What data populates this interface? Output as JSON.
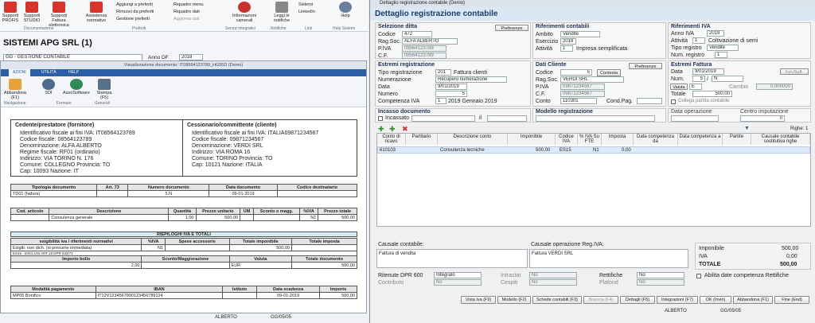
{
  "ribbon": {
    "buttons": [
      {
        "label": "Supporti PROFIS"
      },
      {
        "label": "Supporti STUDIO"
      },
      {
        "label": "Supporti Fattura elettronica"
      },
      {
        "label": "Assistenza normativo"
      }
    ],
    "prefs": [
      "Aggiungi a preferiti",
      "Rimuovi da preferiti",
      "Gestione preferiti"
    ],
    "riquadro": [
      "Riquadro menu",
      "Riquadro dati",
      "Aggiorna dati"
    ],
    "info": "Informazioni camerali",
    "notif": "Leggi le notifiche",
    "links": [
      "Sistemi",
      "LinkedIn"
    ],
    "help": "Help",
    "groups": [
      "Documentazione",
      "Preferiti",
      "Servizi integrativi",
      "Notifiche",
      "Link",
      "Help Sistemi"
    ]
  },
  "company": "SISTEMI APG SRL (1)",
  "gestione": "GG - GESTIONE CONTABILE",
  "anno_df_label": "Anno DF",
  "anno_df": "2018",
  "viewer": {
    "title": "Visualizzazione documento: IT08564123789_HG55D (Demo)",
    "tabs": [
      "AZIONI",
      "UTILITÀ",
      "HELP"
    ],
    "tools": [
      "Abbandona (F1)",
      "SDI",
      "AssoSoftware",
      "Stampa (F5)"
    ],
    "tool_groups": [
      "Navigazione",
      "Formato",
      "Generali"
    ]
  },
  "invoice": {
    "cedente_title": "Cedente/prestatore (fornitore)",
    "cedente": [
      "Identificativo fiscale ai fini IVA: IT08564123789",
      "Codice fiscale: 08564123789",
      "Denominazione: ALFA ALBERTO",
      "Regime fiscale: RF01 (ordinario)",
      "Indirizzo: VIA TORINO N. 176",
      "Comune: COLLEGNO Provincia: TO",
      "Cap: 10093 Nazione: IT"
    ],
    "cess_title": "Cessionario/committente (cliente)",
    "cess": [
      "Identificativo fiscale ai fini IVA: ITALIA09871234567",
      "Codice fiscale: 09871234567",
      "Denominazione: VERDI SRL",
      "Indirizzo: VIA ROMA 16",
      "Comune: TORINO Provincia: TO",
      "Cap: 10121 Nazione: ITALIA"
    ],
    "doc_headers": [
      "Tipologia documento",
      "Art. 73",
      "Numero documento",
      "Data documento",
      "Codice destinatario"
    ],
    "doc_row": [
      "TD01 (fattura)",
      "",
      "5.N",
      "09-01-2019",
      ""
    ],
    "line_headers": [
      "Cod. articolo",
      "Descrizione",
      "Quantità",
      "Prezzo unitario",
      "UM",
      "Sconto o magg.",
      "%IVA",
      "Prezzo totale"
    ],
    "line_row": [
      "",
      "Consulenza generale",
      "1,00",
      "500,00",
      "",
      "",
      "N1",
      "500,00"
    ],
    "riep_title": "RIEPILOGHI IVA E TOTALI",
    "riep_headers": [
      "esigibilità iva / riferimenti normativi",
      "%IVA",
      "Spese accessorie",
      "Totale imponibile",
      "Totale imposta"
    ],
    "riep_row": [
      "Esigib. non dich. (si presume immediata)",
      "N1",
      "",
      "500,00",
      ""
    ],
    "riep_note": "ES15 - ESCLUSI ART.15 DPR 633/72",
    "tot_headers": [
      "Importo bollo",
      "Sconto/Maggiorazione",
      "Valuta",
      "Totale documento"
    ],
    "tot_row": [
      "2,00",
      "",
      "EUR",
      "500,00"
    ],
    "pay_headers": [
      "Modalità pagamento",
      "IBAN",
      "Istituto",
      "Data scadenza",
      "Importo"
    ],
    "pay_row": [
      "MP05 Bonifico",
      "IT12V1234567890123456789124",
      "",
      "09-01-2019",
      "500,00"
    ]
  },
  "status_left": {
    "user": "ALBERTO",
    "code": "GG/05/05"
  },
  "dialog": {
    "wtitle": "Dettaglio registrazione contabile (Demo)",
    "header": "Dettaglio registrazione contabile",
    "sel_ditta": {
      "title": "Selezione ditta",
      "preferenze": "Preferenze",
      "codice_l": "Codice",
      "codice": "472",
      "ragsoc_l": "Rag.Soc.",
      "ragsoc": "ALFA ALBERTO",
      "piva_l": "P.IVA",
      "piva": "08564123789",
      "cf_l": "C.F.",
      "cf": "08564123789"
    },
    "rif_cont": {
      "title": "Riferimenti contabili",
      "ambito_l": "Ambito",
      "ambito": "Vendite",
      "esercizio_l": "Esercizio",
      "esercizio": "2019",
      "attivita_l": "Attività",
      "attivita": "1",
      "attivita_desc": "Impresa semplificata"
    },
    "rif_iva": {
      "title": "Riferimenti IVA",
      "anno_l": "Anno IVA",
      "anno": "2019",
      "attivita_l": "Attività",
      "attivita": "1",
      "attivita_desc": "Coltivazione di semi",
      "tipo_l": "Tipo registro",
      "tipo": "Vendite",
      "num_l": "Num. registro",
      "num": "1"
    },
    "estremi": {
      "title": "Estremi registrazione",
      "tipo_l": "Tipo registrazione",
      "tipo": "201",
      "tipo_desc": "Fattura clienti",
      "num_l": "Numerazione",
      "num": "Recupero numerazione",
      "data_l": "Data",
      "data": "9/01/2019",
      "numero_l": "Numero",
      "numero": "5",
      "comp_l": "Competenza IVA",
      "comp_m": "1",
      "comp": "2019 Gennaio 2019"
    },
    "cliente": {
      "title": "Dati Cliente",
      "preferenze": "Preferenze",
      "codice_l": "Codice",
      "codice": "5",
      "contesta": "Contesta",
      "ragsoc_l": "Rag.Soc.",
      "ragsoc": "VERDI SRL",
      "piva_l": "P.IVA",
      "piva": "09871234567",
      "cf_l": "C.F.",
      "cf": "09871234567",
      "conto_l": "Conto",
      "conto": "110301",
      "condpag_l": "Cond.Pag."
    },
    "fattura": {
      "title": "Estremi Fattura",
      "fel": "Fel./Suff.",
      "data_l": "Data",
      "data": "9/01/2019",
      "num_l": "Num.",
      "num": "5",
      "num_suf": "N",
      "valuta": "Valuta",
      "valuta_v": "E",
      "cambio_l": "Cambio",
      "cambio": "0,000000",
      "totale_l": "Totale",
      "totale": "500,00",
      "collega": "Collega partita contabile"
    },
    "incasso": {
      "title": "Incasso documento",
      "chk": "Incassato",
      "il": "il"
    },
    "modello": {
      "title": "Modello registrazione"
    },
    "dataop": {
      "title": "Data operazione"
    },
    "centro": {
      "title": "Centro imputazione",
      "v": "0"
    },
    "righe": "Righe: 1",
    "grid_headers": [
      "Conto di ricavo",
      "Partitario",
      "Descrizione conto",
      "Imponibile",
      "Codice IVA",
      "% IVA Su FTE",
      "Imposta",
      "Data competenza da",
      "Data competenza a",
      "Partite",
      "Causale contabile sostitutiva righe"
    ],
    "grid_row": {
      "conto": "610103",
      "desc": "Consulenza tecniche",
      "imp": "500,00",
      "cod": "ES15",
      "iva": "N1",
      "imposta": "0,00"
    },
    "causale_l": "Causale contabile:",
    "causale": "Fattura di vendita",
    "causale_iva_l": "Causale operazione Reg.IVA:",
    "causale_iva": "Fattura VERDI SRL",
    "totals": {
      "imp_l": "Imponibile",
      "imp": "500,00",
      "iva_l": "IVA",
      "iva": "0,00",
      "tot_l": "TOTALE",
      "tot": "500,00"
    },
    "ritenute_l": "Ritenute DPR 600",
    "ritenute": "Integrato",
    "contributo_l": "Contributo",
    "contributo": "No",
    "intrastat_l": "Intrastat",
    "intrastat": "No",
    "cespiti_l": "Cespiti",
    "cespiti": "No",
    "rettifiche_l": "Rettifiche",
    "rettifiche": "No",
    "plafond_l": "Plafond",
    "plafond": "No",
    "abilita": "Abilita date competenza Rettifiche",
    "buttons": [
      "Vista Iva (F9)",
      "Modello (F2)",
      "Schede contabili (F3)",
      "Bilancia (F4)",
      "Dettagli (F5)",
      "Integrazioni (F7)",
      "OK (Invio)",
      "Abbandona (F1)",
      "Fine (End)"
    ]
  },
  "status_right": {
    "user": "ALBERTO",
    "code": "GG/05/05"
  }
}
